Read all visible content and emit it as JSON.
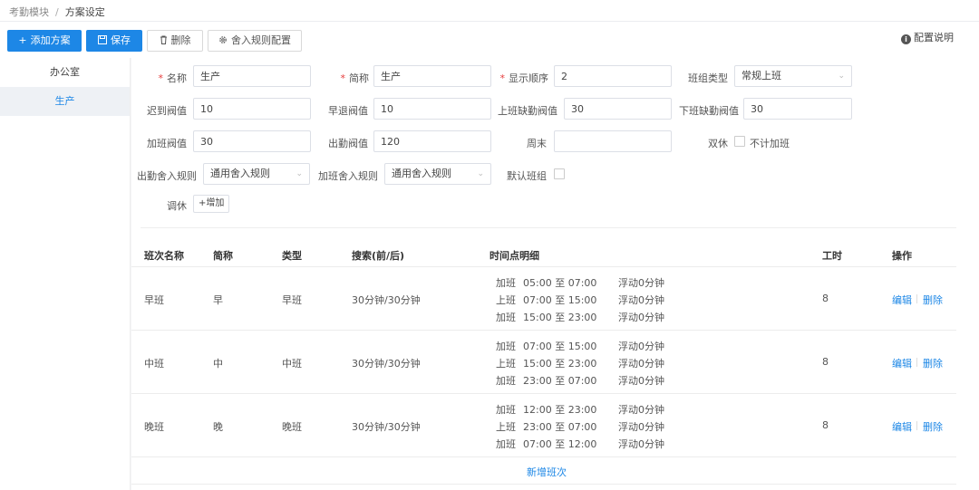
{
  "breadcrumb": {
    "parent": "考勤模块",
    "separator": "/",
    "current": "方案设定"
  },
  "toolbar": {
    "add_label": "添加方案",
    "save_label": "保存",
    "delete_label": "删除",
    "rounding_label": "舍入规则配置",
    "help_label": "配置说明"
  },
  "sidebar": {
    "items": [
      {
        "label": "办公室"
      },
      {
        "label": "生产"
      }
    ]
  },
  "form": {
    "name_label": "名称",
    "name_value": "生产",
    "short_label": "简称",
    "short_value": "生产",
    "order_label": "显示顺序",
    "order_value": "2",
    "shift_type_label": "班组类型",
    "shift_type_value": "常规上班",
    "late_label": "迟到阀值",
    "late_value": "10",
    "early_label": "早退阀值",
    "early_value": "10",
    "absent_on_label": "上班缺勤阀值",
    "absent_on_value": "30",
    "absent_off_label": "下班缺勤阀值",
    "absent_off_value": "30",
    "overtime_label": "加班阀值",
    "overtime_value": "30",
    "attendance_label": "出勤阀值",
    "attendance_value": "120",
    "weekend_label": "周末",
    "weekend_value": "",
    "double_rest_label": "双休",
    "no_overtime_label": "不计加班",
    "attend_rule_label": "出勤舍入规则",
    "attend_rule_value": "通用舍入规则",
    "overtime_rule_label": "加班舍入规则",
    "overtime_rule_value": "通用舍入规则",
    "default_group_label": "默认班组",
    "rest_swap_label": "调休",
    "add_label": "+增加"
  },
  "table": {
    "headers": {
      "name": "班次名称",
      "short": "简称",
      "type": "类型",
      "search": "搜索(前/后)",
      "detail": "时间点明细",
      "hours": "工时",
      "ops": "操作"
    },
    "rows": [
      {
        "name": "早班",
        "short": "早",
        "type": "早班",
        "search": "30分钟/30分钟",
        "hours": "8",
        "details": [
          {
            "kind": "加班",
            "range": "05:00 至 07:00",
            "float": "浮动0分钟"
          },
          {
            "kind": "上班",
            "range": "07:00 至 15:00",
            "float": "浮动0分钟"
          },
          {
            "kind": "加班",
            "range": "15:00 至 23:00",
            "float": "浮动0分钟"
          }
        ]
      },
      {
        "name": "中班",
        "short": "中",
        "type": "中班",
        "search": "30分钟/30分钟",
        "hours": "8",
        "details": [
          {
            "kind": "加班",
            "range": "07:00 至 15:00",
            "float": "浮动0分钟"
          },
          {
            "kind": "上班",
            "range": "15:00 至 23:00",
            "float": "浮动0分钟"
          },
          {
            "kind": "加班",
            "range": "23:00 至 07:00",
            "float": "浮动0分钟"
          }
        ]
      },
      {
        "name": "晚班",
        "short": "晚",
        "type": "晚班",
        "search": "30分钟/30分钟",
        "hours": "8",
        "details": [
          {
            "kind": "加班",
            "range": "12:00 至 23:00",
            "float": "浮动0分钟"
          },
          {
            "kind": "上班",
            "range": "23:00 至 07:00",
            "float": "浮动0分钟"
          },
          {
            "kind": "加班",
            "range": "07:00 至 12:00",
            "float": "浮动0分钟"
          }
        ]
      }
    ],
    "edit_label": "编辑",
    "delete_label": "删除",
    "add_shift_label": "新增班次"
  },
  "colors": {
    "primary": "#1d87e6",
    "required": "#e63c3c",
    "active_bg": "#eef1f5"
  },
  "icons": {
    "add": "plus-icon",
    "save": "save-icon",
    "delete": "trash-icon",
    "rounding": "gear-icon",
    "help": "info-icon",
    "select": "chevron-down-icon"
  }
}
